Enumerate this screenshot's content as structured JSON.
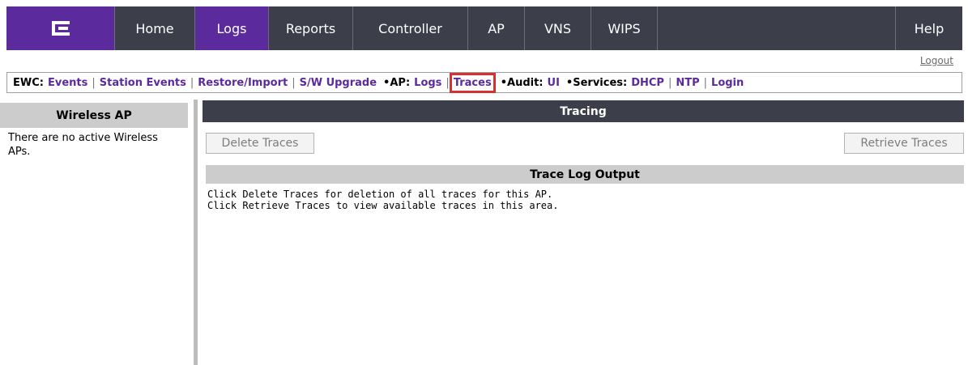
{
  "topnav": {
    "logo_icon": "extreme-networks-logo",
    "items": [
      "Home",
      "Logs",
      "Reports",
      "Controller",
      "AP",
      "VNS",
      "WIPS"
    ],
    "active": "Logs",
    "help": "Help"
  },
  "logout": "Logout",
  "subnav": {
    "ewc_label": "EWC:",
    "ewc_links": [
      "Events",
      "Station Events",
      "Restore/Import",
      "S/W Upgrade"
    ],
    "ap_label": "•AP:",
    "ap_links": [
      "Logs",
      "Traces"
    ],
    "audit_label": "•Audit:",
    "audit_links": [
      "UI"
    ],
    "services_label": "•Services:",
    "services_links": [
      "DHCP",
      "NTP",
      "Login"
    ],
    "highlight_color": "#d93030"
  },
  "left": {
    "title": "Wireless AP",
    "message": "There are no active Wireless APs."
  },
  "tracing": {
    "title": "Tracing",
    "delete_button": "Delete Traces",
    "retrieve_button": "Retrieve Traces",
    "output_title": "Trace Log Output",
    "output_line1": "Click Delete Traces for deletion of all traces for this AP.",
    "output_line2": "Click Retrieve Traces to view available traces in this area."
  },
  "colors": {
    "brand_purple": "#5b2a9d",
    "nav_dark": "#3c3f4a"
  }
}
